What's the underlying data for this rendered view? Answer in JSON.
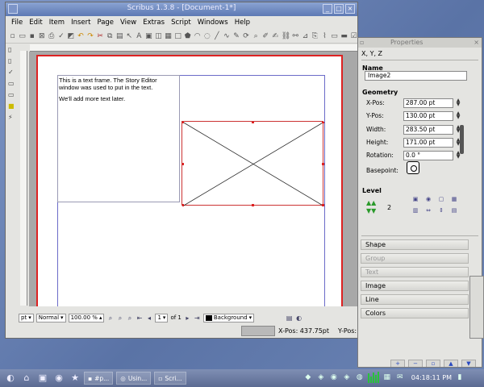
{
  "window": {
    "title": "Scribus 1.3.8 - [Document-1*]",
    "controls": [
      "_",
      "□",
      "×"
    ]
  },
  "menubar": [
    "File",
    "Edit",
    "Item",
    "Insert",
    "Page",
    "View",
    "Extras",
    "Script",
    "Windows",
    "Help"
  ],
  "canvas": {
    "text_frame_lines": [
      "This is a text frame. The Story Editor window was used to put in the text.",
      "We'll add more text later."
    ]
  },
  "statusbar": {
    "unit": "pt",
    "mode": "Normal",
    "zoom": "100.00 %",
    "page_current": "1",
    "page_total": "of 1",
    "layer": "Background"
  },
  "coords": {
    "x": "X-Pos: 437.75pt",
    "y": "Y-Pos:"
  },
  "properties": {
    "title": "Properties",
    "tab": "X, Y, Z",
    "name_label": "Name",
    "name_value": "Image2",
    "geometry_label": "Geometry",
    "fields": [
      {
        "label": "X-Pos:",
        "value": "287.00 pt"
      },
      {
        "label": "Y-Pos:",
        "value": "130.00 pt"
      },
      {
        "label": "Width:",
        "value": "283.50 pt"
      },
      {
        "label": "Height:",
        "value": "171.00 pt"
      },
      {
        "label": "Rotation:",
        "value": "0.0 °"
      }
    ],
    "basepoint_label": "Basepoint:",
    "level_label": "Level",
    "level_value": "2",
    "sections": [
      {
        "label": "Shape",
        "enabled": true
      },
      {
        "label": "Group",
        "enabled": false
      },
      {
        "label": "Text",
        "enabled": false
      },
      {
        "label": "Image",
        "enabled": true
      },
      {
        "label": "Line",
        "enabled": true
      },
      {
        "label": "Colors",
        "enabled": true
      }
    ]
  },
  "taskbar": {
    "buttons": [
      "#p...",
      "Usin...",
      "Scri..."
    ],
    "clock": "04:18:11 PM"
  },
  "colors": {
    "page_border": "#dd2222",
    "frame_selected": "#cc3333",
    "margin": "#6b6bc8",
    "level_arrows": "#2a9a2a"
  }
}
